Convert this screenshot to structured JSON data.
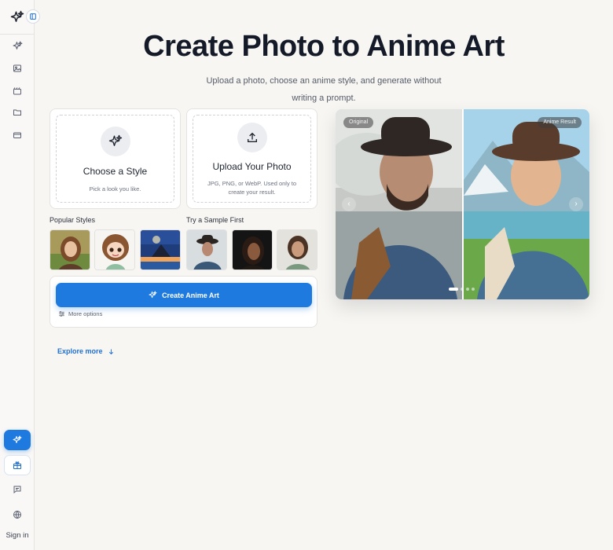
{
  "sidebar": {
    "sign_in": "Sign in",
    "items": [
      "sparkle-icon",
      "image-icon",
      "film-icon",
      "folder-icon",
      "card-icon"
    ]
  },
  "header": {
    "title": "Create Photo to Anime Art",
    "subtitle": "Upload a photo, choose an anime style, and generate without writing a prompt."
  },
  "style_card": {
    "title": "Choose a Style",
    "subtitle": "Pick a look you like."
  },
  "upload_card": {
    "title": "Upload Your Photo",
    "subtitle": "JPG, PNG, or WebP. Used only to create your result."
  },
  "popular_styles": {
    "label": "Popular Styles"
  },
  "samples": {
    "label": "Try a Sample First"
  },
  "actions": {
    "create_label": "Create Anime Art",
    "more_options": "More options",
    "explore_more": "Explore more"
  },
  "preview": {
    "original_badge": "Original",
    "result_badge": "Anime Result",
    "active_slide": 1,
    "slide_count": 4
  },
  "colors": {
    "accent": "#1f7ae0",
    "background": "#f7f6f3"
  }
}
